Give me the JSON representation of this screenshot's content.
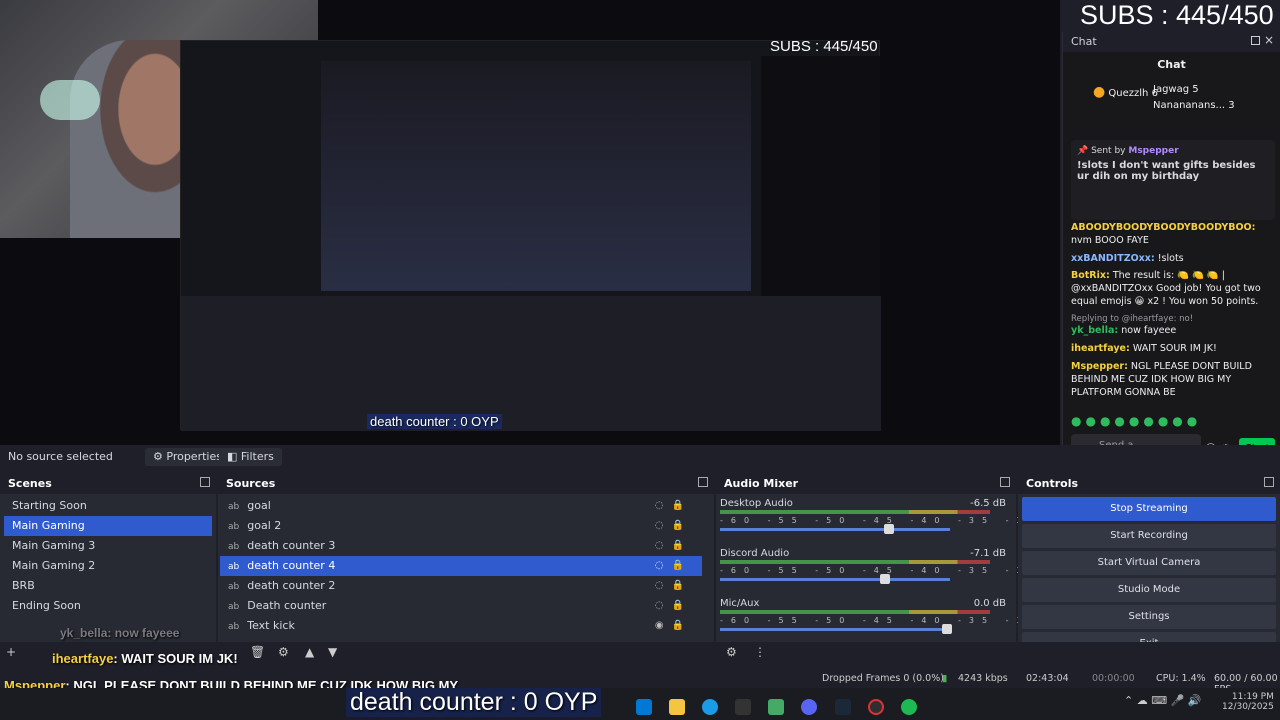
{
  "stream": {
    "subs_counter": "SUBS : 445/450",
    "death_counter": "death counter : 0 OYP",
    "overlay_messages": [
      {
        "user": "yk_bella",
        "text": "now fayeee"
      },
      {
        "user": "iheartfaye",
        "text": "WAIT SOUR IM JK!"
      },
      {
        "user": "Mspepper",
        "text": "NGL PLEASE DONT BUILD BEHIND ME CUZ IDK HOW BIG MY PLATFORM GONNA BE"
      }
    ]
  },
  "chat": {
    "window_title": "Chat",
    "header": "Chat",
    "top_gifters": [
      {
        "name": "Quezzlh",
        "count": "6"
      },
      {
        "name": "Jagwag",
        "count": "5"
      },
      {
        "name": "Nanananans...",
        "count": "3"
      }
    ],
    "pinned": {
      "sent_by_label": "Sent by",
      "user": "Mspepper",
      "text": "!slots I don't want gifts besides ur dih on my birthday"
    },
    "messages": [
      {
        "user": "ABOODYBOODYBOODYBOODYBOO:",
        "text": "nvm BOOO FAYE",
        "color": "#f5d142"
      },
      {
        "user": "xxBANDITZOxx:",
        "text": "!slots",
        "color": "#8cb8ff"
      },
      {
        "user": "BotRix:",
        "text": "The result is: 🍋 🍋 🍋 | @xxBANDITZOxx Good job! You got two equal emojis 😀 x2 ! You won 50 points.",
        "color": "#f5d142"
      },
      {
        "user": "Replying to @iheartfaye: no!",
        "text": "",
        "color": "#9a9aa4"
      },
      {
        "user": "yk_bella:",
        "text": "now fayeee",
        "color": "#2ebd5e"
      },
      {
        "user": "iheartfaye:",
        "text": "WAIT SOUR IM JK!",
        "color": "#f5d142"
      },
      {
        "user": "Mspepper:",
        "text": "NGL PLEASE DONT BUILD BEHIND ME CUZ IDK HOW BIG MY PLATFORM GONNA BE",
        "color": "#f5d142"
      }
    ],
    "input_placeholder": "Send a message",
    "send_label": "Chat"
  },
  "toolbar": {
    "no_source": "No source selected",
    "properties": "Properties",
    "filters": "Filters"
  },
  "scenes": {
    "title": "Scenes",
    "items": [
      "Starting Soon",
      "Main Gaming",
      "Main Gaming 3",
      "Main Gaming 2",
      "BRB",
      "Ending Soon"
    ],
    "selected": "Main Gaming"
  },
  "sources": {
    "title": "Sources",
    "items": [
      "goal",
      "goal 2",
      "death counter 3",
      "death counter 4",
      "death counter 2",
      "Death counter",
      "Text kick"
    ],
    "selected": "death counter 4"
  },
  "mixer": {
    "title": "Audio Mixer",
    "channels": [
      {
        "name": "Desktop Audio",
        "db": "-6.5 dB",
        "level": 0.82
      },
      {
        "name": "Discord Audio",
        "db": "-7.1 dB",
        "level": 0.8
      },
      {
        "name": "Mic/Aux",
        "db": "0.0 dB",
        "level": 0.97
      }
    ],
    "scale": [
      "-60",
      "-55",
      "-50",
      "-45",
      "-40",
      "-35",
      "-30",
      "-25",
      "-20",
      "-15",
      "-10",
      "-5",
      "0"
    ]
  },
  "controls": {
    "title": "Controls",
    "buttons": [
      "Stop Streaming",
      "Start Recording",
      "Start Virtual Camera",
      "Studio Mode",
      "Settings",
      "Exit"
    ]
  },
  "status": {
    "dropped": "Dropped Frames 0 (0.0%)",
    "bitrate": "4243 kbps",
    "live_time": "02:43:04",
    "rec_time": "00:00:00",
    "cpu": "CPU: 1.4%",
    "fps": "60.00 / 60.00 FPS"
  },
  "taskbar": {
    "time": "11:19 PM",
    "date": "12/30/2025"
  },
  "colors": {
    "accent": "#2f5bce",
    "chat_green": "#00c853",
    "panel": "#272a33",
    "titlebar": "#1e1f29"
  }
}
